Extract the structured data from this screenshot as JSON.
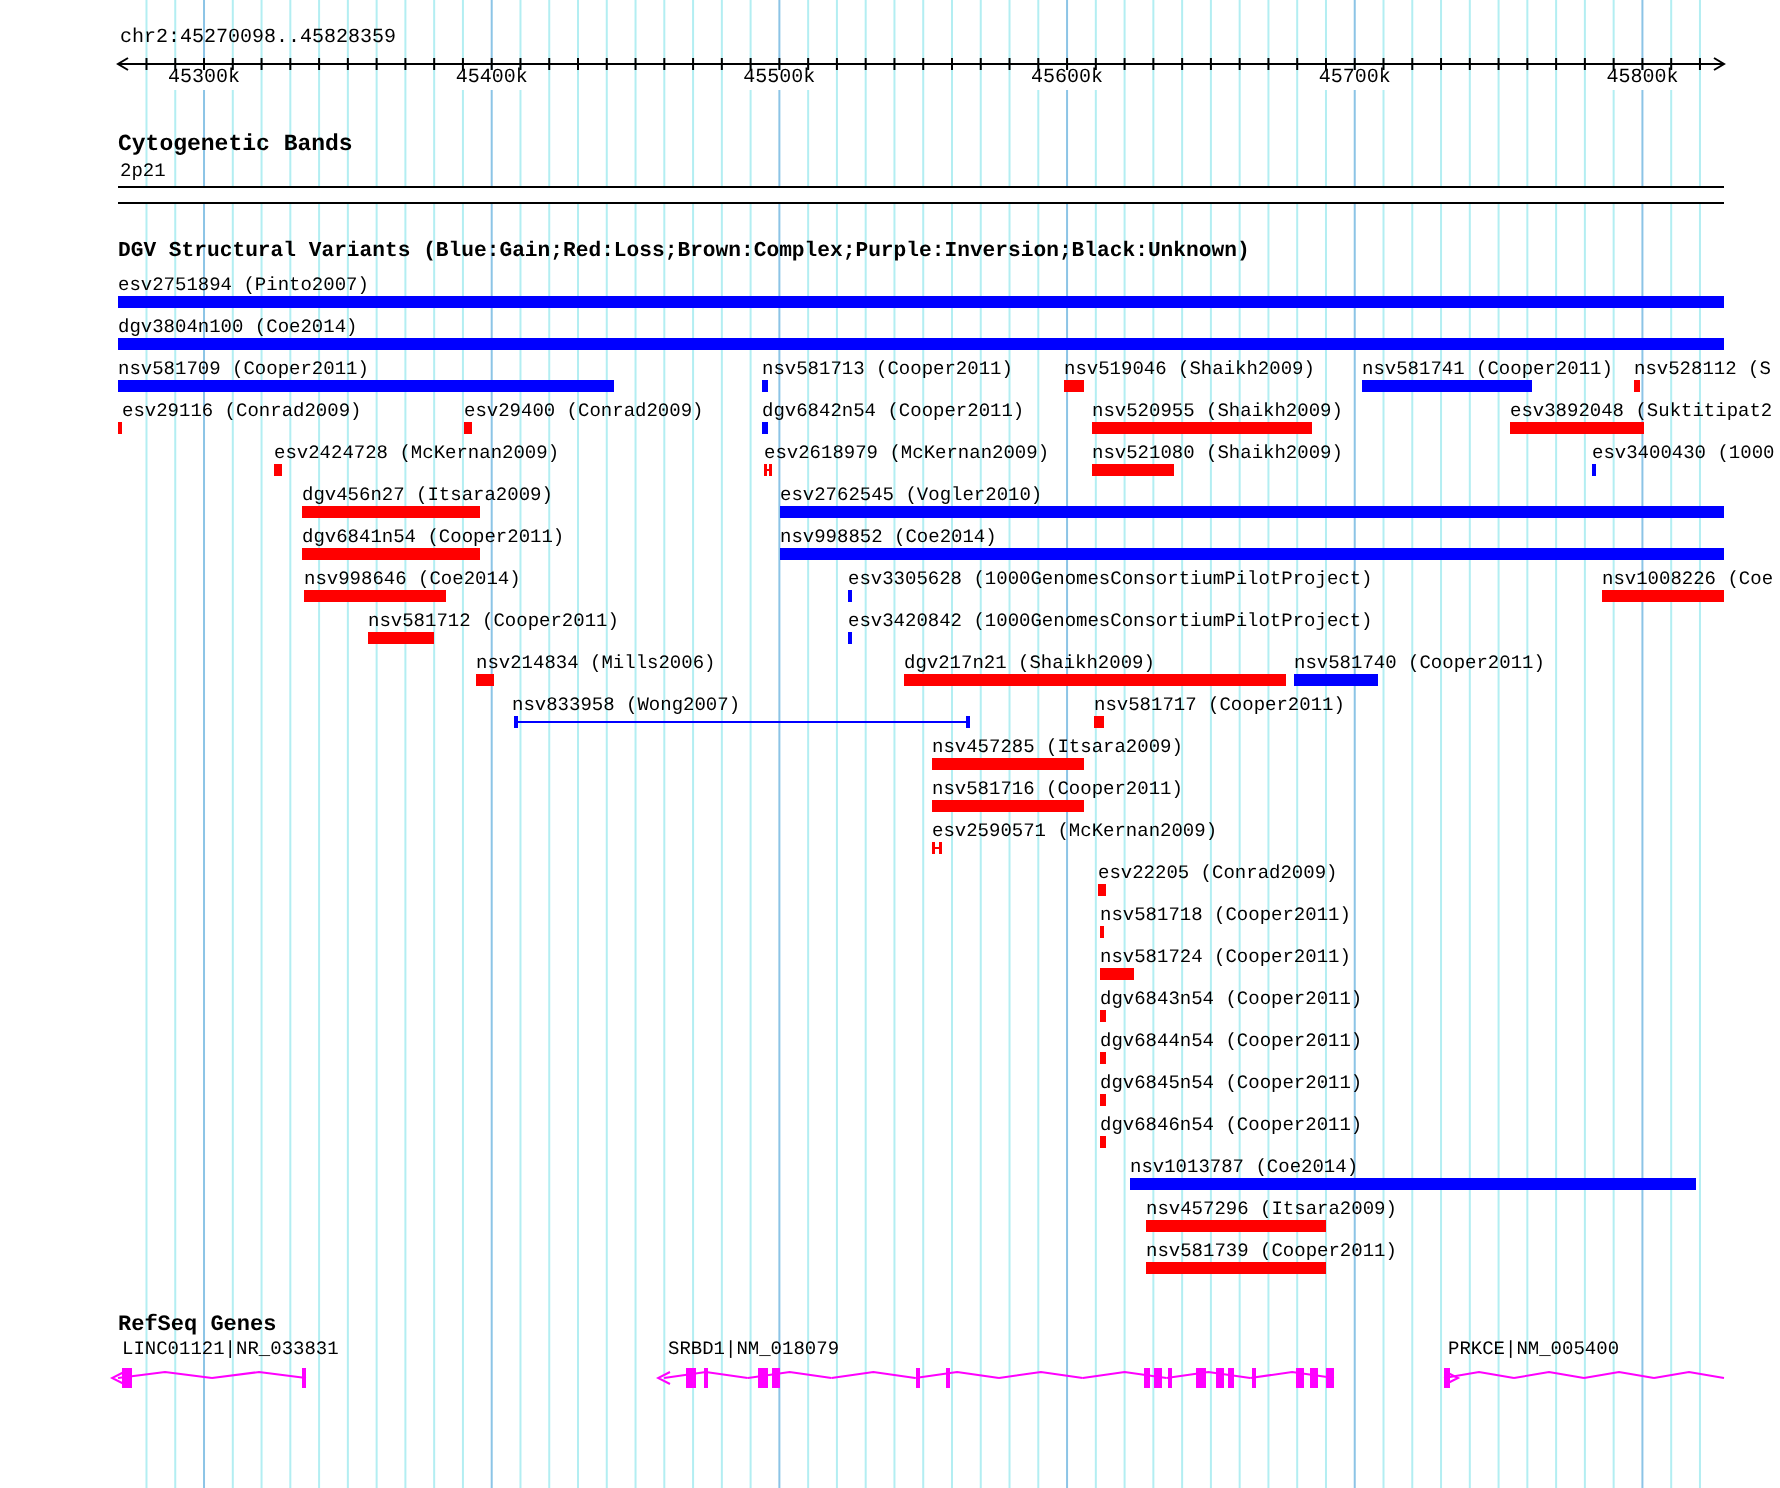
{
  "ruler": {
    "location": "chr2:45270098..45828359",
    "ticks": [
      "45300k",
      "45400k",
      "45500k",
      "45600k",
      "45700k",
      "45800k"
    ]
  },
  "cytogenetic_bands": {
    "title": "Cytogenetic Bands",
    "band": "2p21"
  },
  "dgv_track": {
    "title": "DGV Structural Variants (Blue:Gain;Red:Loss;Brown:Complex;Purple:Inversion;Black:Unknown)",
    "features": [
      {
        "label": "esv2751894 (Pinto2007)",
        "color": "#0000ff",
        "kind": "bar"
      },
      {
        "label": "dgv3804n100 (Coe2014)",
        "color": "#0000ff",
        "kind": "bar"
      },
      {
        "label": "nsv581709 (Cooper2011)",
        "color": "#0000ff",
        "kind": "bar"
      },
      {
        "label": "nsv581713 (Cooper2011)",
        "color": "#0000ff",
        "kind": "bar"
      },
      {
        "label": "nsv519046 (Shaikh2009)",
        "color": "#ff0000",
        "kind": "bar"
      },
      {
        "label": "nsv581741 (Cooper2011)",
        "color": "#0000ff",
        "kind": "bar"
      },
      {
        "label": "nsv528112 (S",
        "color": "#ff0000",
        "kind": "bar"
      },
      {
        "label": "esv29116 (Conrad2009)",
        "color": "#ff0000",
        "kind": "bar"
      },
      {
        "label": "esv29400 (Conrad2009)",
        "color": "#ff0000",
        "kind": "bar"
      },
      {
        "label": "dgv6842n54 (Cooper2011)",
        "color": "#0000ff",
        "kind": "bar"
      },
      {
        "label": "nsv520955 (Shaikh2009)",
        "color": "#ff0000",
        "kind": "bar"
      },
      {
        "label": "esv3892048 (Suktitipat2",
        "color": "#ff0000",
        "kind": "bar"
      },
      {
        "label": "esv2424728 (McKernan2009)",
        "color": "#ff0000",
        "kind": "bar"
      },
      {
        "label": "esv2618979 (McKernan2009)",
        "color": "#ff0000",
        "kind": "pair"
      },
      {
        "label": "nsv521080 (Shaikh2009)",
        "color": "#ff0000",
        "kind": "bar"
      },
      {
        "label": "esv3400430 (1000",
        "color": "#0000ff",
        "kind": "bar"
      },
      {
        "label": "dgv456n27 (Itsara2009)",
        "color": "#ff0000",
        "kind": "bar"
      },
      {
        "label": "esv2762545 (Vogler2010)",
        "color": "#0000ff",
        "kind": "bar"
      },
      {
        "label": "dgv6841n54 (Cooper2011)",
        "color": "#ff0000",
        "kind": "bar"
      },
      {
        "label": "nsv998852 (Coe2014)",
        "color": "#0000ff",
        "kind": "bar"
      },
      {
        "label": "nsv998646 (Coe2014)",
        "color": "#ff0000",
        "kind": "bar"
      },
      {
        "label": "esv3305628 (1000GenomesConsortiumPilotProject)",
        "color": "#0000ff",
        "kind": "bar"
      },
      {
        "label": "nsv1008226 (Coe",
        "color": "#ff0000",
        "kind": "bar"
      },
      {
        "label": "nsv581712 (Cooper2011)",
        "color": "#ff0000",
        "kind": "bar"
      },
      {
        "label": "esv3420842 (1000GenomesConsortiumPilotProject)",
        "color": "#0000ff",
        "kind": "bar"
      },
      {
        "label": "nsv214834 (Mills2006)",
        "color": "#ff0000",
        "kind": "bar"
      },
      {
        "label": "dgv217n21 (Shaikh2009)",
        "color": "#ff0000",
        "kind": "bar"
      },
      {
        "label": "nsv581740 (Cooper2011)",
        "color": "#0000ff",
        "kind": "bar"
      },
      {
        "label": "nsv833958 (Wong2007)",
        "color": "#0000ff",
        "kind": "span"
      },
      {
        "label": "nsv581717 (Cooper2011)",
        "color": "#ff0000",
        "kind": "bar"
      },
      {
        "label": "nsv457285 (Itsara2009)",
        "color": "#ff0000",
        "kind": "bar"
      },
      {
        "label": "nsv581716 (Cooper2011)",
        "color": "#ff0000",
        "kind": "bar"
      },
      {
        "label": "esv2590571 (McKernan2009)",
        "color": "#ff0000",
        "kind": "pair"
      },
      {
        "label": "esv22205 (Conrad2009)",
        "color": "#ff0000",
        "kind": "bar"
      },
      {
        "label": "nsv581718 (Cooper2011)",
        "color": "#ff0000",
        "kind": "bar"
      },
      {
        "label": "nsv581724 (Cooper2011)",
        "color": "#ff0000",
        "kind": "bar"
      },
      {
        "label": "dgv6843n54 (Cooper2011)",
        "color": "#ff0000",
        "kind": "bar"
      },
      {
        "label": "dgv6844n54 (Cooper2011)",
        "color": "#ff0000",
        "kind": "bar"
      },
      {
        "label": "dgv6845n54 (Cooper2011)",
        "color": "#ff0000",
        "kind": "bar"
      },
      {
        "label": "dgv6846n54 (Cooper2011)",
        "color": "#ff0000",
        "kind": "bar"
      },
      {
        "label": "nsv1013787 (Coe2014)",
        "color": "#0000ff",
        "kind": "bar"
      },
      {
        "label": "nsv457296 (Itsara2009)",
        "color": "#ff0000",
        "kind": "bar"
      },
      {
        "label": "nsv581739 (Cooper2011)",
        "color": "#ff0000",
        "kind": "bar"
      }
    ]
  },
  "refseq_genes": {
    "title": "RefSeq Genes",
    "genes": [
      {
        "label": "LINC01121|NR_033831",
        "kind": "minus"
      },
      {
        "label": "SRBD1|NM_018079",
        "kind": "minus"
      },
      {
        "label": "PRKCE|NM_005400",
        "kind": "plus"
      }
    ]
  }
}
